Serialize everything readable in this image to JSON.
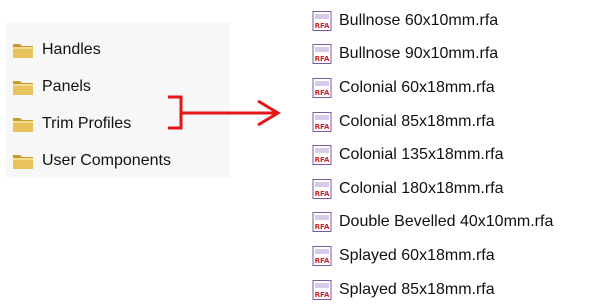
{
  "folders": [
    {
      "label": "Handles",
      "icon": "folder-icon"
    },
    {
      "label": "Panels",
      "icon": "folder-icon"
    },
    {
      "label": "Trim Profiles",
      "icon": "folder-icon"
    },
    {
      "label": "User Components",
      "icon": "folder-icon"
    }
  ],
  "files": [
    {
      "label": "Bullnose 60x10mm.rfa",
      "icon": "rfa-file-icon"
    },
    {
      "label": "Bullnose 90x10mm.rfa",
      "icon": "rfa-file-icon"
    },
    {
      "label": "Colonial 60x18mm.rfa",
      "icon": "rfa-file-icon"
    },
    {
      "label": "Colonial 85x18mm.rfa",
      "icon": "rfa-file-icon"
    },
    {
      "label": "Colonial 135x18mm.rfa",
      "icon": "rfa-file-icon"
    },
    {
      "label": "Colonial 180x18mm.rfa",
      "icon": "rfa-file-icon"
    },
    {
      "label": "Double Bevelled 40x10mm.rfa",
      "icon": "rfa-file-icon"
    },
    {
      "label": "Splayed 60x18mm.rfa",
      "icon": "rfa-file-icon"
    },
    {
      "label": "Splayed 85x18mm.rfa",
      "icon": "rfa-file-icon"
    }
  ],
  "file_icon_text": "RFA",
  "colors": {
    "arrow": "#e81416",
    "folder_fill": "#e8c25a",
    "folder_dark": "#c99a2e",
    "rfa_purple": "#7a5aa8",
    "rfa_red": "#c9252c"
  }
}
